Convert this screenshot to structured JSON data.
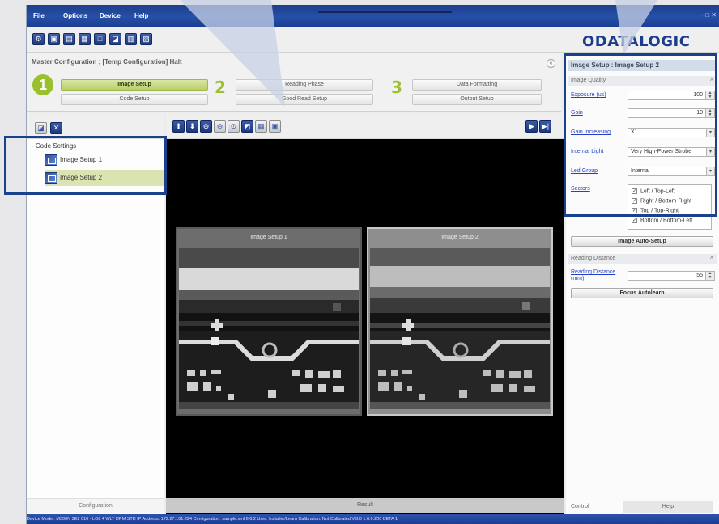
{
  "menu": [
    "File",
    "Options",
    "Device",
    "Help"
  ],
  "window_controls": "–□ ✕",
  "toolbar_icons": [
    "connect-icon",
    "save-icon",
    "load-icon",
    "config-icon",
    "device-icon",
    "image-icon",
    "monitor-icon",
    "statistics-icon"
  ],
  "logo_text": "ODATALOGIC",
  "wizard": {
    "title": "Master Configuration ; [Temp Configuration] Halt",
    "collapse": "«",
    "step1": "1",
    "step2": "2",
    "step3": "3",
    "image_setup": "Image Setup",
    "code_setup": "Code Setup",
    "reading_phase": "Reading Phase",
    "good_read_setup": "Good Read Setup",
    "data_formatting": "Data Formatting",
    "output_setup": "Output Setup"
  },
  "left": {
    "tree_root": "- Code Settings",
    "items": [
      "Image Setup 1",
      "Image Setup 2"
    ],
    "footer": "Configuration"
  },
  "center": {
    "panels": [
      "Image Setup 1",
      "Image Setup 2"
    ],
    "footer": "Result"
  },
  "right": {
    "title": "Image Setup : Image Setup 2",
    "section_quality": "Image Quality",
    "exposure_label": "Exposure (us)",
    "exposure_value": "100",
    "gain_label": "Gain",
    "gain_value": "10",
    "gain_increasing_label": "Gain Increasing",
    "gain_increasing_value": "X1",
    "internal_light_label": "Internal Light",
    "internal_light_value": "Very High-Power Strobe",
    "led_group_label": "Led Group",
    "led_group_value": "Internal",
    "sectors_label": "Sectors",
    "sectors": [
      "Left / Top-Left",
      "Right / Bottom-Right",
      "Top / Top-Right",
      "Bottom / Bottom-Left"
    ],
    "auto_setup": "Image Auto-Setup",
    "section_distance": "Reading Distance",
    "reading_distance_label": "Reading Distance (mm)",
    "reading_distance_value": "55",
    "focus_button": "Focus Autolearn",
    "tab_control": "Control",
    "tab_help": "Help"
  },
  "status": "Device Model: M300N 3E2 010 - LOL 4 WLT DPM STD  IP Address: 172.27.101.224  Configuration: sample.xml  6.6.2  User: Installer/Learn  Calibration: Not Calibrated                                                                      V.8.0   1.6.0.200 BETA 1",
  "colors": {
    "accent": "#1d3d8c",
    "green": "#9bc02d",
    "callout": "#1a418b"
  }
}
